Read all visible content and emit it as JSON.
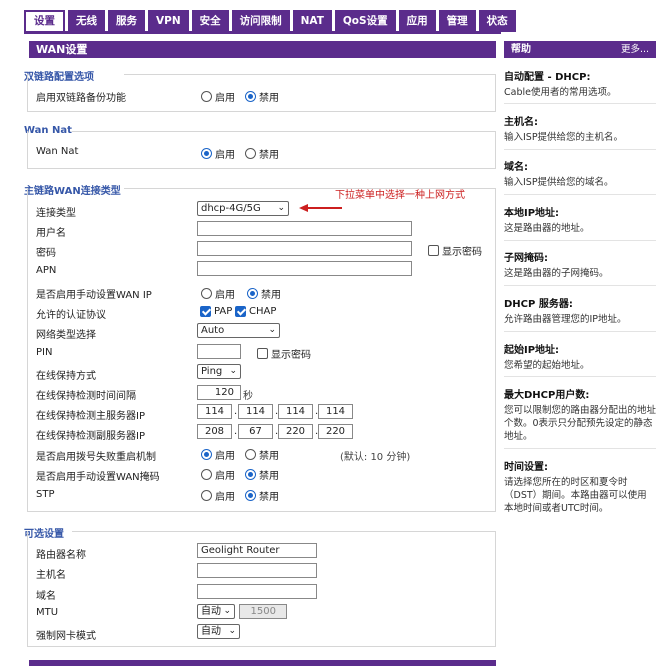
{
  "nav": [
    "设置",
    "无线",
    "服务",
    "VPN",
    "安全",
    "访问限制",
    "NAT",
    "QoS设置",
    "应用",
    "管理",
    "状态"
  ],
  "panel_title": "WAN设置",
  "dual_link": {
    "title": "双链路配置选项",
    "label": "启用双链路备份功能",
    "enable": "启用",
    "disable": "禁用"
  },
  "wan_nat": {
    "title": "Wan Nat",
    "label": "Wan Nat",
    "enable": "启用",
    "disable": "禁用"
  },
  "main": {
    "title": "主链路WAN连接类型",
    "annotation": "下拉菜单中选择一种上网方式",
    "conn_type_label": "连接类型",
    "conn_type_value": "dhcp-4G/5G",
    "username_label": "用户名",
    "password_label": "密码",
    "show_password": "显示密码",
    "apn_label": "APN",
    "manual_wan_ip_label": "是否启用手动设置WAN IP",
    "auth_label": "允许的认证协议",
    "pap": "PAP",
    "chap": "CHAP",
    "net_type_label": "网络类型选择",
    "net_type_value": "Auto",
    "pin_label": "PIN",
    "pin_show": "显示密码",
    "keepalive_label": "在线保持方式",
    "keepalive_value": "Ping",
    "interval_label": "在线保持检测时间间隔",
    "interval_value": "120",
    "interval_unit": "秒",
    "primary_server_label": "在线保持检测主服务器IP",
    "primary_ip": [
      "114",
      "114",
      "114",
      "114"
    ],
    "secondary_server_label": "在线保持检测副服务器IP",
    "secondary_ip": [
      "208",
      "67",
      "220",
      "220"
    ],
    "redial_label": "是否启用拨号失败重启机制",
    "redial_note": "(默认: 10 分钟)",
    "manual_mask_label": "是否启用手动设置WAN掩码",
    "stp_label": "STP",
    "enable": "启用",
    "disable": "禁用"
  },
  "optional": {
    "title": "可选设置",
    "router_name_label": "路由器名称",
    "router_name_value": "Geolight Router",
    "hostname_label": "主机名",
    "domain_label": "域名",
    "mtu_label": "MTU",
    "mtu_mode": "自动",
    "mtu_value": "1500",
    "nic_label": "强制网卡模式",
    "nic_value": "自动"
  },
  "help": {
    "title": "帮助",
    "more": "更多...",
    "items": [
      {
        "t": "自动配置 - DHCP:",
        "d": "Cable使用者的常用选项。"
      },
      {
        "t": "主机名:",
        "d": "输入ISP提供给您的主机名。"
      },
      {
        "t": "域名:",
        "d": "输入ISP提供给您的域名。"
      },
      {
        "t": "本地IP地址:",
        "d": "这是路由器的地址。"
      },
      {
        "t": "子网掩码:",
        "d": "这是路由器的子网掩码。"
      },
      {
        "t": "DHCP 服务器:",
        "d": "允许路由器管理您的IP地址。"
      },
      {
        "t": "起始IP地址:",
        "d": "您希望的起始地址。"
      },
      {
        "t": "最大DHCP用户数:",
        "d": "您可以限制您的路由器分配出的地址个数。0表示只分配预先设定的静态地址。"
      },
      {
        "t": "时间设置:",
        "d": "请选择您所在的时区和夏令时（DST）期间。本路由器可以使用本地时间或者UTC时间。"
      }
    ]
  },
  "colors": {
    "accent": "#5b2c8c",
    "section": "#3657a8",
    "annotation": "#cc1f1f",
    "radio": "#1a64c8"
  }
}
